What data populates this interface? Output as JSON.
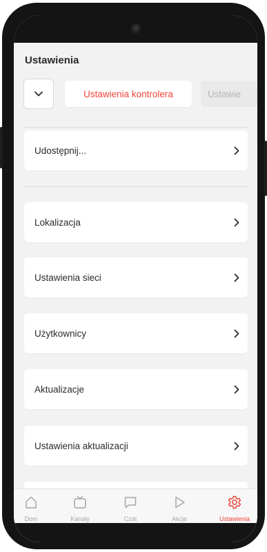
{
  "header": {
    "title": "Ustawienia"
  },
  "filters": {
    "active_chip": "Ustawienia kontrolera",
    "inactive_chip": "Ustawie"
  },
  "settings": {
    "share_item": "Udostępnij...",
    "items": [
      "Lokalizacja",
      "Ustawienia sieci",
      "Użytkownicy",
      "Aktualizacje",
      "Ustawienia aktualizacji"
    ]
  },
  "tabbar": {
    "tabs": [
      {
        "label": "Dom",
        "icon": "home-icon"
      },
      {
        "label": "Kanały",
        "icon": "tv-icon"
      },
      {
        "label": "Czat",
        "icon": "chat-icon"
      },
      {
        "label": "Akcje",
        "icon": "play-icon"
      },
      {
        "label": "Ustawienia",
        "icon": "gear-icon"
      }
    ],
    "active_index": 4
  },
  "colors": {
    "accent": "#f0453a",
    "background": "#f2f2f2",
    "card": "#ffffff",
    "inactive": "#a6a6a6"
  }
}
